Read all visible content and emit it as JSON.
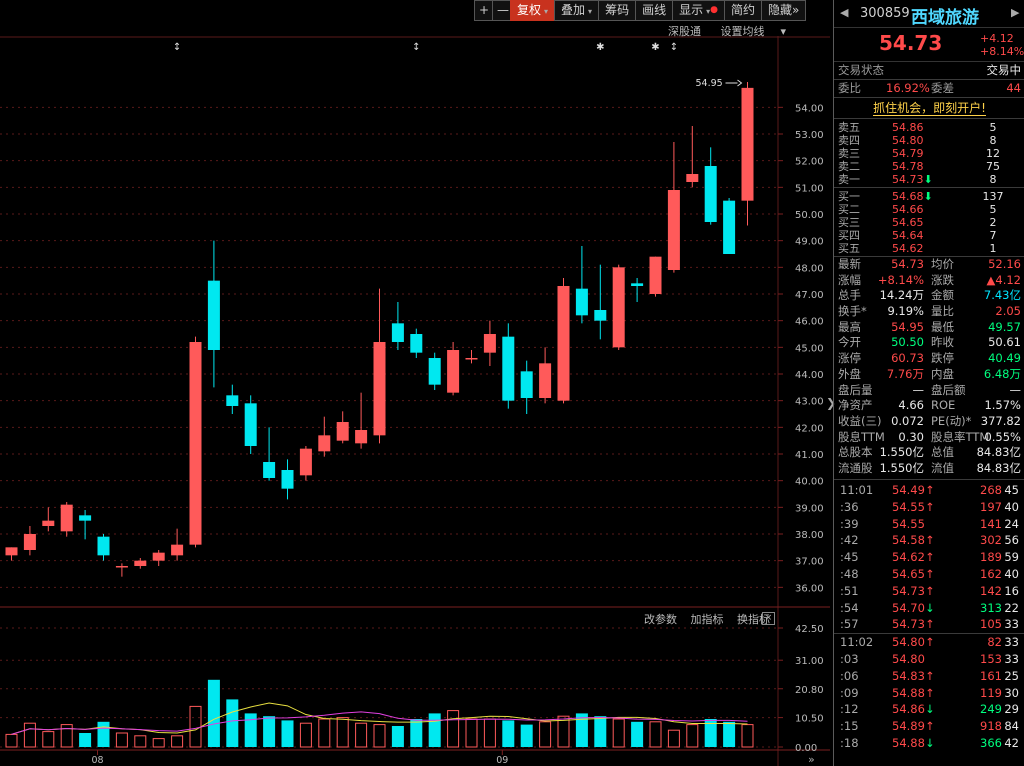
{
  "toolbar": {
    "plus": "+",
    "minus": "—",
    "items": [
      {
        "label": "复权",
        "caret": "▾",
        "active": true
      },
      {
        "label": "叠加",
        "caret": "▾",
        "active": false
      },
      {
        "label": "筹码",
        "caret": "",
        "active": false
      },
      {
        "label": "画线",
        "caret": "",
        "active": false
      },
      {
        "label": "显示",
        "caret": "▾",
        "active": false
      },
      {
        "label": "简约",
        "caret": "",
        "active": false
      },
      {
        "label": "隐藏",
        "caret": "",
        "active": false
      }
    ],
    "hide_arrows": "»"
  },
  "subbar": {
    "left": "深股通",
    "right": "设置均线",
    "caret": "▾"
  },
  "indicator_bar": {
    "a": "改参数",
    "b": "加指标",
    "c": "换指标",
    "close": "×"
  },
  "chart_data": [
    {
      "type": "candlestick",
      "x_labels": [
        {
          "label": "08",
          "index": 5
        },
        {
          "label": "09",
          "index": 27
        }
      ],
      "y_ticks": [
        "54.00",
        "53.00",
        "52.00",
        "51.00",
        "50.00",
        "49.00",
        "48.00",
        "47.00",
        "46.00",
        "45.00",
        "44.00",
        "43.00",
        "42.00",
        "41.00",
        "40.00",
        "39.00",
        "38.00",
        "37.00",
        "36.00"
      ],
      "ylim": [
        35.3,
        56.0
      ],
      "annotation": "54.95",
      "candles": [
        {
          "o": 37.2,
          "h": 37.5,
          "c": 37.5,
          "l": 37.0
        },
        {
          "o": 37.4,
          "h": 38.3,
          "c": 38.0,
          "l": 37.2
        },
        {
          "o": 38.3,
          "h": 39.0,
          "c": 38.5,
          "l": 38.1
        },
        {
          "o": 38.1,
          "h": 39.2,
          "c": 39.1,
          "l": 37.9
        },
        {
          "o": 38.7,
          "h": 38.9,
          "c": 38.5,
          "l": 37.8
        },
        {
          "o": 37.9,
          "h": 38.0,
          "c": 37.2,
          "l": 37.0
        },
        {
          "o": 36.8,
          "h": 36.9,
          "c": 36.8,
          "l": 36.4
        },
        {
          "o": 36.8,
          "h": 37.1,
          "c": 37.0,
          "l": 36.7
        },
        {
          "o": 37.0,
          "h": 37.4,
          "c": 37.3,
          "l": 36.8
        },
        {
          "o": 37.2,
          "h": 38.2,
          "c": 37.6,
          "l": 37.0
        },
        {
          "o": 37.6,
          "h": 45.4,
          "c": 45.2,
          "l": 37.5
        },
        {
          "o": 47.5,
          "h": 49.0,
          "c": 44.9,
          "l": 43.5
        },
        {
          "o": 43.2,
          "h": 43.6,
          "c": 42.8,
          "l": 42.5
        },
        {
          "o": 42.9,
          "h": 43.2,
          "c": 41.3,
          "l": 41.0
        },
        {
          "o": 40.7,
          "h": 42.0,
          "c": 40.1,
          "l": 40.0
        },
        {
          "o": 40.4,
          "h": 40.8,
          "c": 39.7,
          "l": 39.3
        },
        {
          "o": 40.2,
          "h": 41.3,
          "c": 41.2,
          "l": 40.0
        },
        {
          "o": 41.1,
          "h": 42.4,
          "c": 41.7,
          "l": 40.9
        },
        {
          "o": 41.5,
          "h": 42.6,
          "c": 42.2,
          "l": 41.4
        },
        {
          "o": 41.4,
          "h": 43.3,
          "c": 41.9,
          "l": 41.2
        },
        {
          "o": 41.7,
          "h": 47.2,
          "c": 45.2,
          "l": 41.4
        },
        {
          "o": 45.9,
          "h": 46.7,
          "c": 45.2,
          "l": 44.9
        },
        {
          "o": 45.5,
          "h": 45.7,
          "c": 44.8,
          "l": 44.6
        },
        {
          "o": 44.6,
          "h": 44.8,
          "c": 43.6,
          "l": 43.4
        },
        {
          "o": 43.3,
          "h": 45.2,
          "c": 44.9,
          "l": 43.2
        },
        {
          "o": 44.6,
          "h": 44.9,
          "c": 44.6,
          "l": 44.4
        },
        {
          "o": 44.8,
          "h": 46.0,
          "c": 45.5,
          "l": 44.3
        },
        {
          "o": 45.4,
          "h": 45.9,
          "c": 43.0,
          "l": 42.7
        },
        {
          "o": 44.1,
          "h": 44.5,
          "c": 43.1,
          "l": 42.5
        },
        {
          "o": 43.1,
          "h": 45.0,
          "c": 44.4,
          "l": 42.9
        },
        {
          "o": 43.0,
          "h": 47.6,
          "c": 47.3,
          "l": 42.9
        },
        {
          "o": 47.2,
          "h": 48.8,
          "c": 46.2,
          "l": 45.9
        },
        {
          "o": 46.4,
          "h": 48.1,
          "c": 46.0,
          "l": 45.3
        },
        {
          "o": 45.0,
          "h": 48.1,
          "c": 48.0,
          "l": 44.9
        },
        {
          "o": 47.4,
          "h": 47.6,
          "c": 47.3,
          "l": 46.7
        },
        {
          "o": 47.0,
          "h": 48.4,
          "c": 48.4,
          "l": 46.9
        },
        {
          "o": 47.9,
          "h": 52.7,
          "c": 50.9,
          "l": 47.8
        },
        {
          "o": 51.2,
          "h": 53.3,
          "c": 51.5,
          "l": 51.0
        },
        {
          "o": 51.8,
          "h": 52.5,
          "c": 49.7,
          "l": 49.6
        },
        {
          "o": 50.5,
          "h": 50.6,
          "c": 48.5,
          "l": 48.5
        },
        {
          "o": 50.5,
          "h": 54.95,
          "c": 54.73,
          "l": 49.57
        }
      ],
      "markers": [
        {
          "index": 9,
          "sym": "↕"
        },
        {
          "index": 22,
          "sym": "↕"
        },
        {
          "index": 32,
          "sym": "✱"
        },
        {
          "index": 35,
          "sym": "✱"
        },
        {
          "index": 36,
          "sym": "↕"
        }
      ]
    },
    {
      "type": "bar",
      "y_ticks": [
        "42.50",
        "31.00",
        "20.80",
        "10.50",
        "0.00"
      ],
      "ylim": [
        0,
        42.5
      ],
      "values": [
        4.5,
        8.5,
        5.5,
        8,
        5,
        9,
        5,
        4,
        3,
        4,
        14.5,
        24,
        17,
        12,
        11,
        9.5,
        8.5,
        10,
        10.5,
        8.5,
        8,
        7.5,
        10,
        12,
        13,
        10,
        10,
        9.5,
        8,
        9,
        11,
        12,
        11,
        10,
        9,
        9,
        6,
        8,
        10,
        9,
        8
      ]
    }
  ],
  "panel": {
    "nav_prev": "◀",
    "nav_next": "▶",
    "code": "300859",
    "name": "西域旅游",
    "price": "54.73",
    "change": "+4.12",
    "change_pct": "+8.14%",
    "state_label": "交易状态",
    "state_value": "交易中",
    "weibi_label": "委比",
    "weibi_value": "16.92%",
    "weicha_label": "委差",
    "weicha_value": "44",
    "banner": "抓住机会，即刻开户!",
    "asks": [
      {
        "label": "卖五",
        "price": "54.86",
        "vol": "5",
        "arrow": ""
      },
      {
        "label": "卖四",
        "price": "54.80",
        "vol": "8",
        "arrow": ""
      },
      {
        "label": "卖三",
        "price": "54.79",
        "vol": "12",
        "arrow": ""
      },
      {
        "label": "卖二",
        "price": "54.78",
        "vol": "75",
        "arrow": ""
      },
      {
        "label": "卖一",
        "price": "54.73",
        "vol": "8",
        "arrow": "⬇"
      }
    ],
    "bids": [
      {
        "label": "买一",
        "price": "54.68",
        "vol": "137",
        "arrow": "⬇"
      },
      {
        "label": "买二",
        "price": "54.66",
        "vol": "5",
        "arrow": ""
      },
      {
        "label": "买三",
        "price": "54.65",
        "vol": "2",
        "arrow": ""
      },
      {
        "label": "买四",
        "price": "54.64",
        "vol": "7",
        "arrow": ""
      },
      {
        "label": "买五",
        "price": "54.62",
        "vol": "1",
        "arrow": ""
      }
    ],
    "stats": [
      {
        "a": "最新",
        "b": "54.73",
        "bc": "red",
        "c": "均价",
        "d": "52.16",
        "dc": "red"
      },
      {
        "a": "涨幅",
        "b": "+8.14%",
        "bc": "red",
        "c": "涨跌",
        "d": "▲4.12",
        "dc": "red"
      },
      {
        "a": "总手",
        "b": "14.24万",
        "bc": "wht",
        "c": "金额",
        "d": "7.43亿",
        "dc": "cyan"
      },
      {
        "a": "换手*",
        "b": "9.19%",
        "bc": "wht",
        "c": "量比",
        "d": "2.05",
        "dc": "red"
      },
      {
        "a": "最高",
        "b": "54.95",
        "bc": "red",
        "c": "最低",
        "d": "49.57",
        "dc": "grn"
      },
      {
        "a": "今开",
        "b": "50.50",
        "bc": "grn",
        "c": "昨收",
        "d": "50.61",
        "dc": "wht"
      },
      {
        "a": "涨停",
        "b": "60.73",
        "bc": "red",
        "c": "跌停",
        "d": "40.49",
        "dc": "grn"
      },
      {
        "a": "外盘",
        "b": "7.76万",
        "bc": "red",
        "c": "内盘",
        "d": "6.48万",
        "dc": "grn"
      },
      {
        "a": "盘后量",
        "b": "—",
        "bc": "wht",
        "c": "盘后额",
        "d": "—",
        "dc": "wht"
      },
      {
        "a": "净资产",
        "b": "4.66",
        "bc": "wht",
        "c": "ROE",
        "d": "1.57%",
        "dc": "wht"
      },
      {
        "a": "收益(三)",
        "b": "0.072",
        "bc": "wht",
        "c": "PE(动)*",
        "d": "377.82",
        "dc": "wht"
      },
      {
        "a": "股息TTM",
        "b": "0.30",
        "bc": "wht",
        "c": "股息率TTM",
        "d": "0.55%",
        "dc": "wht"
      },
      {
        "a": "总股本",
        "b": "1.550亿",
        "bc": "wht",
        "c": "总值",
        "d": "84.83亿",
        "dc": "wht"
      },
      {
        "a": "流通股",
        "b": "1.550亿",
        "bc": "wht",
        "c": "流值",
        "d": "84.83亿",
        "dc": "wht"
      }
    ],
    "ticks": [
      {
        "t": "11:01",
        "p": "54.49",
        "ar": "up",
        "v": "268",
        "vc": "red",
        "n": "45"
      },
      {
        "t": ":36",
        "p": "54.55",
        "ar": "up",
        "v": "197",
        "vc": "red",
        "n": "40"
      },
      {
        "t": ":39",
        "p": "54.55",
        "ar": "",
        "v": "141",
        "vc": "red",
        "n": "24"
      },
      {
        "t": ":42",
        "p": "54.58",
        "ar": "up",
        "v": "302",
        "vc": "red",
        "n": "56"
      },
      {
        "t": ":45",
        "p": "54.62",
        "ar": "up",
        "v": "189",
        "vc": "red",
        "n": "59"
      },
      {
        "t": ":48",
        "p": "54.65",
        "ar": "up",
        "v": "162",
        "vc": "red",
        "n": "40"
      },
      {
        "t": ":51",
        "p": "54.73",
        "ar": "up",
        "v": "142",
        "vc": "red",
        "n": "16"
      },
      {
        "t": ":54",
        "p": "54.70",
        "ar": "dn",
        "v": "313",
        "vc": "grn",
        "n": "22"
      },
      {
        "t": ":57",
        "p": "54.73",
        "ar": "up",
        "v": "105",
        "vc": "red",
        "n": "33"
      },
      {
        "t": "11:02",
        "p": "54.80",
        "ar": "up",
        "v": "82",
        "vc": "red",
        "n": "33"
      },
      {
        "t": ":03",
        "p": "54.80",
        "ar": "",
        "v": "153",
        "vc": "red",
        "n": "33"
      },
      {
        "t": ":06",
        "p": "54.83",
        "ar": "up",
        "v": "161",
        "vc": "red",
        "n": "25"
      },
      {
        "t": ":09",
        "p": "54.88",
        "ar": "up",
        "v": "119",
        "vc": "red",
        "n": "30"
      },
      {
        "t": ":12",
        "p": "54.86",
        "ar": "dn",
        "v": "249",
        "vc": "grn",
        "n": "29"
      },
      {
        "t": ":15",
        "p": "54.89",
        "ar": "up",
        "v": "918",
        "vc": "red",
        "n": "84"
      },
      {
        "t": ":18",
        "p": "54.88",
        "ar": "dn",
        "v": "366",
        "vc": "grn",
        "n": "42"
      }
    ]
  },
  "colors": {
    "up": "#ff5a5a",
    "down": "#00e8f0",
    "ma1": "#e8e040",
    "ma2": "#e040e0",
    "grid": "#5a1a1a"
  }
}
